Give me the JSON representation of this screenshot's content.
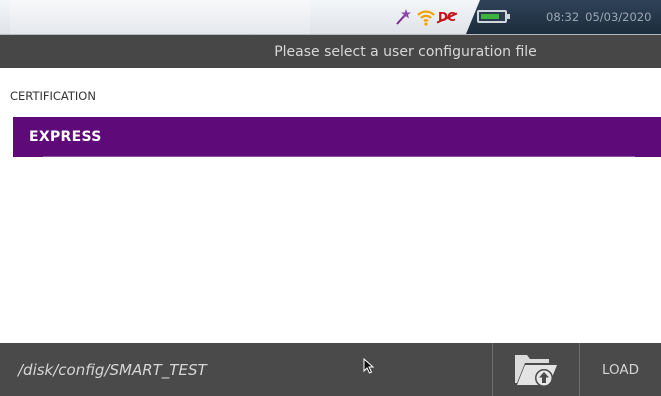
{
  "status_bar": {
    "time": "08:32",
    "date": "05/03/2020",
    "icons": [
      "wand-icon",
      "wifi-icon",
      "dc-power-icon",
      "battery-icon"
    ]
  },
  "title_bar": {
    "title": "Please select a user configuration file"
  },
  "content": {
    "section_label": "CERTIFICATION",
    "items": [
      {
        "label": "EXPRESS",
        "selected": true
      }
    ]
  },
  "bottom_bar": {
    "path": "/disk/config/SMART_TEST",
    "open_folder_icon": "folder-upload-icon",
    "load_label": "LOAD"
  },
  "colors": {
    "selected_item": "#5e0a78",
    "title_bar": "#474747",
    "bottom_bar": "#4a4a4a"
  }
}
